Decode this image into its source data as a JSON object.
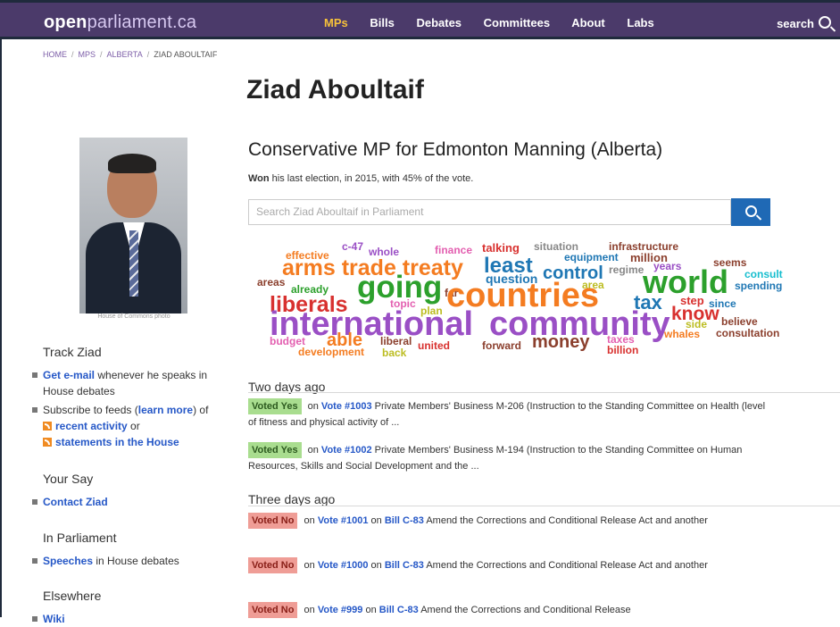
{
  "brand": {
    "part1": "open",
    "part2": "parliament.ca"
  },
  "nav": {
    "mps": "MPs",
    "bills": "Bills",
    "debates": "Debates",
    "committees": "Committees",
    "about": "About",
    "labs": "Labs"
  },
  "search_link": "search",
  "breadcrumb": {
    "home": "HOME",
    "mps": "MPS",
    "province": "ALBERTA",
    "current": "ZIAD ABOULTAIF"
  },
  "mp": {
    "name": "Ziad Aboultaif",
    "subtitle": "Conservative MP for Edmonton Manning (Alberta)",
    "won_bold": "Won",
    "won_text": " his last election, in 2015, with 45% of the vote.",
    "photo_credit": "House of Commons photo"
  },
  "search": {
    "placeholder": "Search Ziad Aboultaif in Parliament"
  },
  "sidebar": {
    "track_title": "Track Ziad",
    "email_link": "Get e-mail",
    "email_text": " whenever he speaks in House debates",
    "feeds_text": "Subscribe to feeds (",
    "learn_more": "learn more",
    "feeds_text2": ") of",
    "recent_activity": "recent activity",
    "or": " or",
    "statements": "statements in the House",
    "yoursay_title": "Your Say",
    "contact": "Contact Ziad",
    "parliament_title": "In Parliament",
    "speeches": "Speeches",
    "speeches_text": " in House debates",
    "elsewhere_title": "Elsewhere",
    "wiki": "Wiki"
  },
  "wordcloud": {
    "words": [
      {
        "text": "effective",
        "color": "#f47c21"
      },
      {
        "text": "c-47",
        "color": "#9a4fc5"
      },
      {
        "text": "whole",
        "color": "#9a4fc5"
      },
      {
        "text": "finance",
        "color": "#e35fb0"
      },
      {
        "text": "talking",
        "color": "#d8312f"
      },
      {
        "text": "situation",
        "color": "#888888"
      },
      {
        "text": "infrastructure",
        "color": "#8b3f2d"
      },
      {
        "text": "equipment",
        "color": "#1f77b4"
      },
      {
        "text": "million",
        "color": "#8b3f2d"
      },
      {
        "text": "arms trade treaty",
        "color": "#f47c21"
      },
      {
        "text": "least",
        "color": "#1f77b4"
      },
      {
        "text": "question",
        "color": "#1f77b4"
      },
      {
        "text": "regime",
        "color": "#888888"
      },
      {
        "text": "years",
        "color": "#9a4fc5"
      },
      {
        "text": "seems",
        "color": "#8b3f2d"
      },
      {
        "text": "consult",
        "color": "#17becf"
      },
      {
        "text": "spending",
        "color": "#1f77b4"
      },
      {
        "text": "areas",
        "color": "#8b3f2d"
      },
      {
        "text": "already",
        "color": "#2ca02c"
      },
      {
        "text": "going",
        "color": "#2ca02c"
      },
      {
        "text": "far",
        "color": "#8b3f2d"
      },
      {
        "text": "control",
        "color": "#1f77b4"
      },
      {
        "text": "area",
        "color": "#bcbd22"
      },
      {
        "text": "world",
        "color": "#2ca02c"
      },
      {
        "text": "liberals",
        "color": "#d8312f"
      },
      {
        "text": "topic",
        "color": "#e35fb0"
      },
      {
        "text": "plan",
        "color": "#bcbd22"
      },
      {
        "text": "countries",
        "color": "#f47c21"
      },
      {
        "text": "tax",
        "color": "#1f77b4"
      },
      {
        "text": "step",
        "color": "#d8312f"
      },
      {
        "text": "since",
        "color": "#1f77b4"
      },
      {
        "text": "know",
        "color": "#d8312f"
      },
      {
        "text": "international",
        "color": "#9a4fc5"
      },
      {
        "text": "community",
        "color": "#9a4fc5"
      },
      {
        "text": "side",
        "color": "#bcbd22"
      },
      {
        "text": "believe",
        "color": "#8b3f2d"
      },
      {
        "text": "whales",
        "color": "#f47c21"
      },
      {
        "text": "consultation",
        "color": "#8b3f2d"
      },
      {
        "text": "budget",
        "color": "#e35fb0"
      },
      {
        "text": "able",
        "color": "#f47c21"
      },
      {
        "text": "liberal",
        "color": "#8b3f2d"
      },
      {
        "text": "united",
        "color": "#d8312f"
      },
      {
        "text": "forward",
        "color": "#8b3f2d"
      },
      {
        "text": "money",
        "color": "#8b3f2d"
      },
      {
        "text": "taxes",
        "color": "#e35fb0"
      },
      {
        "text": "development",
        "color": "#f47c21"
      },
      {
        "text": "back",
        "color": "#bcbd22"
      },
      {
        "text": "billion",
        "color": "#d8312f"
      }
    ]
  },
  "activity": {
    "group1_label": "Two days ago",
    "group2_label": "Three days ago",
    "items": [
      {
        "badge": "Voted Yes",
        "on1": " on ",
        "vote": "Vote #1003",
        "text": " Private Members' Business M-206 (Instruction to the Standing Committee on Health (level of fitness and physical activity of ..."
      },
      {
        "badge": "Voted Yes",
        "on1": " on ",
        "vote": "Vote #1002",
        "text": " Private Members' Business M-194 (Instruction to the Standing Committee on Human Resources, Skills and Social Development and the ..."
      },
      {
        "badge": "Voted No",
        "on1": " on ",
        "vote": "Vote #1001",
        "on2": " on ",
        "bill": "Bill C-83",
        "text": " Amend the Corrections and Conditional Release Act and another"
      },
      {
        "badge": "Voted No",
        "on1": " on ",
        "vote": "Vote #1000",
        "on2": " on ",
        "bill": "Bill C-83",
        "text": " Amend the Corrections and Conditional Release Act and another"
      },
      {
        "badge": "Voted No",
        "on1": " on ",
        "vote": "Vote #999",
        "on2": " on ",
        "bill": "Bill C-83",
        "text": " Amend the Corrections and Conditional Release"
      }
    ]
  }
}
